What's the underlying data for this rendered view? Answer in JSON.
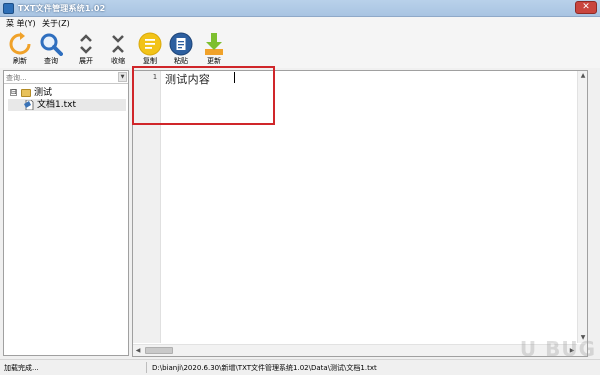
{
  "window": {
    "title": "TXT文件管理系统1.02",
    "close_glyph": "✕"
  },
  "menu": {
    "items": [
      "菜 单(Y)",
      "关于(Z)"
    ]
  },
  "toolbar": {
    "refresh": {
      "label": "刷新",
      "icon": "refresh-icon"
    },
    "query": {
      "label": "查询",
      "icon": "search-icon"
    },
    "expand": {
      "label": "展开",
      "icon": "chevron-up-down-icon"
    },
    "collapse": {
      "label": "收缩",
      "icon": "chevron-collapse-icon"
    },
    "copy": {
      "label": "复制",
      "icon": "copy-icon"
    },
    "paste": {
      "label": "粘贴",
      "icon": "paste-icon"
    },
    "update": {
      "label": "更新",
      "icon": "download-arrow-icon"
    }
  },
  "sidebar": {
    "search_placeholder": "查询...",
    "tree": {
      "root": {
        "expander": "⊟",
        "label": "测试"
      },
      "file": {
        "label": "文档1.txt"
      }
    }
  },
  "editor": {
    "line_number": "1",
    "content": "测试内容"
  },
  "status": {
    "left": "加载完成...",
    "path": "D:\\bianji\\2020.6.30\\新增\\TXT文件管理系统1.02\\Data\\测试\\文档1.txt"
  },
  "watermark": "U BUG",
  "colors": {
    "highlight": "#d0262a",
    "refresh": "#f0a22a",
    "query": "#2f6fbf",
    "copy": "#f2c318",
    "paste": "#2d5f9f",
    "update": "#7dbf2f"
  }
}
